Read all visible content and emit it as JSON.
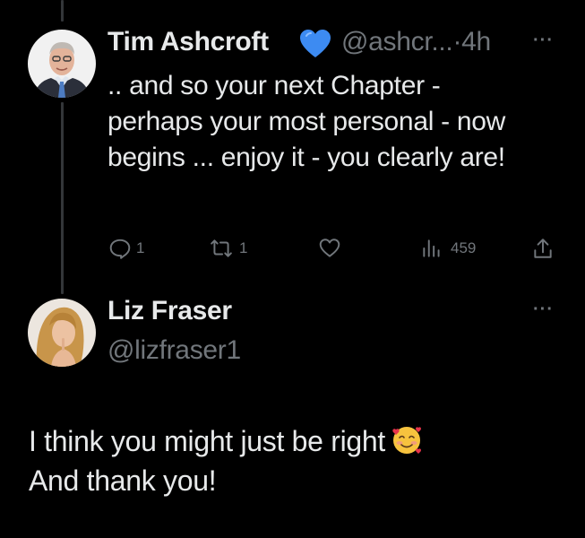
{
  "colors": {
    "background": "#000000",
    "text": "#e7e9ea",
    "muted": "#71767b",
    "verified_heart": "#3d8bf2"
  },
  "tweet": {
    "author_name": "Tim Ashcroft",
    "badge_icon": "blue-heart-icon",
    "handle_time": "@ashcr...·4h",
    "more_icon": "more-icon",
    "text": ".. and so your next Chapter - perhaps your most personal - now begins ... enjoy it - you clearly are!",
    "actions": {
      "reply_count": "1",
      "retweet_count": "1",
      "like_count": "",
      "views_count": "459"
    }
  },
  "reply": {
    "author_name": "Liz Fraser",
    "handle": "@lizfraser1",
    "more_icon": "more-icon",
    "line1": "I think you might just be right",
    "line2": "And thank you!",
    "emoji_icon": "smiling-face-with-hearts-icon"
  }
}
